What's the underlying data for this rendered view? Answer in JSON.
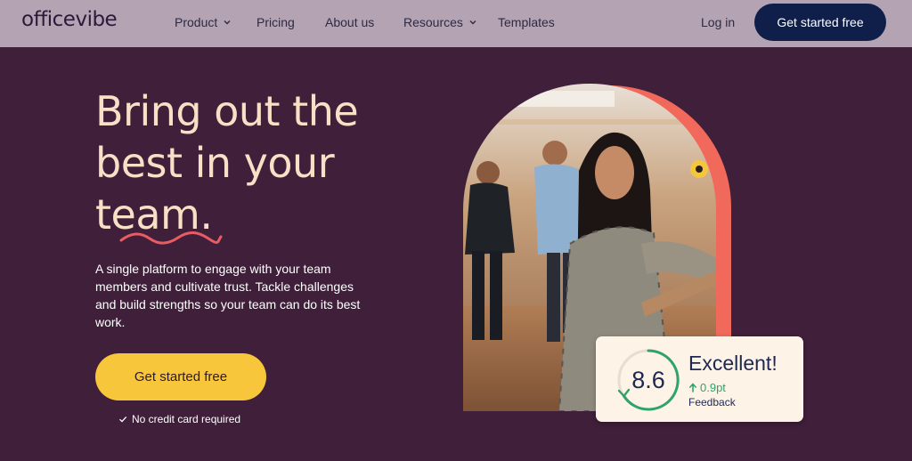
{
  "brand": {
    "logo_text": "officevibe"
  },
  "nav": {
    "items": [
      {
        "label": "Product",
        "has_dropdown": true
      },
      {
        "label": "Pricing",
        "has_dropdown": false
      },
      {
        "label": "About us",
        "has_dropdown": false
      },
      {
        "label": "Resources",
        "has_dropdown": true
      },
      {
        "label": "Templates",
        "has_dropdown": false
      }
    ],
    "login_label": "Log in",
    "cta_label": "Get started free"
  },
  "hero": {
    "headline_lines": [
      "Bring out the",
      "best in your",
      "team."
    ],
    "description": "A single platform to engage with your team members and cultivate trust. Tackle challenges and build strengths so your team can do its best work.",
    "cta_label": "Get started free",
    "note": "No credit card required",
    "note_icon": "check-icon"
  },
  "score_card": {
    "score": "8.6",
    "rating": "Excellent!",
    "delta": "0.9pt",
    "delta_icon": "arrow-up-icon",
    "label": "Feedback"
  },
  "colors": {
    "background": "#3f1f3a",
    "nav_background": "#b3a3b3",
    "headline": "#f9dfc5",
    "accent_coral": "#f0695a",
    "cta_yellow": "#f8c63a",
    "nav_cta": "#0f1f4a",
    "positive_green": "#2fa46a"
  }
}
